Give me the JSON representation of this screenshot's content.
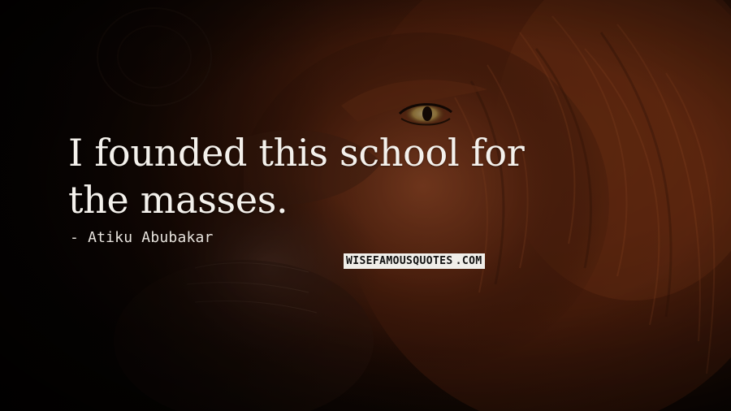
{
  "quote": {
    "line1": "I founded this school for",
    "line2": "the masses.",
    "author": "- Atiku Abubakar"
  },
  "watermark": {
    "main": "WISEFAMOUSQUOTES",
    "tld": ".COM"
  },
  "background": {
    "subject": "lion-face",
    "colors": {
      "base": "#0d0704",
      "mane": "#7a3416",
      "mane_light": "#b2582a",
      "eye": "#d8b66a"
    }
  }
}
